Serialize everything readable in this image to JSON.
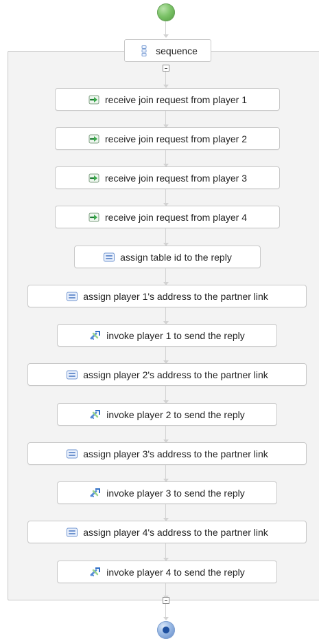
{
  "diagram": {
    "start": {
      "label": ""
    },
    "sequence": {
      "label": "sequence"
    },
    "activities": [
      {
        "label": "receive join request from player 1",
        "kind": "receive"
      },
      {
        "label": "receive join request from player 2",
        "kind": "receive"
      },
      {
        "label": "receive join request from player 3",
        "kind": "receive"
      },
      {
        "label": "receive join request from player 4",
        "kind": "receive"
      },
      {
        "label": "assign table id to the reply",
        "kind": "assign"
      },
      {
        "label": "assign player 1's address to the partner link",
        "kind": "assign"
      },
      {
        "label": "invoke player 1 to send the reply",
        "kind": "invoke"
      },
      {
        "label": "assign player 2's address to the partner link",
        "kind": "assign"
      },
      {
        "label": "invoke player 2 to send the reply",
        "kind": "invoke"
      },
      {
        "label": "assign player 3's address to the partner link",
        "kind": "assign"
      },
      {
        "label": "invoke player 3 to send the reply",
        "kind": "invoke"
      },
      {
        "label": "assign player 4's address to the partner link",
        "kind": "assign"
      },
      {
        "label": "invoke player 4 to send the reply",
        "kind": "invoke"
      }
    ]
  },
  "icons": {
    "start": "start-node-icon",
    "end": "end-node-icon",
    "sequence": "sequence-icon",
    "receive": "receive-icon",
    "assign": "assign-icon",
    "invoke": "invoke-icon",
    "collapse": "collapse-icon"
  },
  "colors": {
    "start_green": "#7bc267",
    "end_blue": "#1d4f9f",
    "box_border": "#c8c8c8",
    "scope_fill": "#f3f3f3",
    "connector": "#d2d2d2",
    "receive_green": "#39a84a",
    "assign_blue": "#6e93cf",
    "invoke_blue": "#4f86cf"
  }
}
